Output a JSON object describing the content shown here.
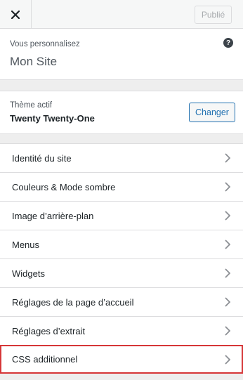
{
  "header": {
    "publish_label": "Publié"
  },
  "info": {
    "label": "Vous personnalisez",
    "site_title": "Mon Site",
    "help_symbol": "?"
  },
  "theme": {
    "label": "Thème actif",
    "name": "Twenty Twenty-One",
    "change_label": "Changer"
  },
  "menu": {
    "items": [
      {
        "label": "Identité du site"
      },
      {
        "label": "Couleurs & Mode sombre"
      },
      {
        "label": "Image d’arrière-plan"
      },
      {
        "label": "Menus"
      },
      {
        "label": "Widgets"
      },
      {
        "label": "Réglages de la page d’accueil"
      },
      {
        "label": "Réglages d’extrait"
      },
      {
        "label": "CSS additionnel"
      }
    ]
  },
  "colors": {
    "highlight": "#d63638",
    "accent": "#2271b1"
  },
  "icons": {
    "close": "close-icon",
    "help": "help-icon",
    "chevron": "chevron-right-icon"
  }
}
